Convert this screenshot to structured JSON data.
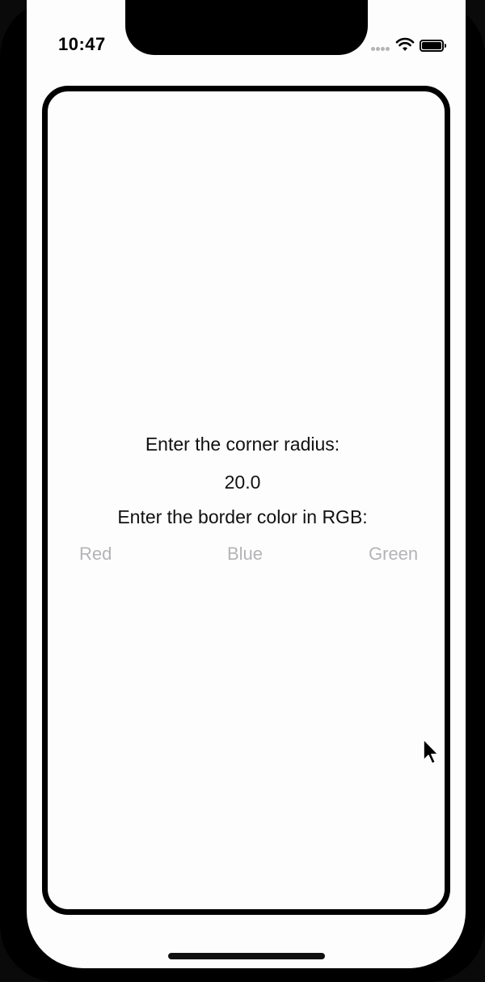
{
  "status_bar": {
    "time": "10:47",
    "signal_icon": "signal-dots-icon",
    "wifi_icon": "wifi-icon",
    "battery_icon": "battery-icon"
  },
  "form": {
    "corner_radius_label": "Enter the corner radius:",
    "corner_radius_value": "20.0",
    "border_color_label": "Enter the border color in RGB:",
    "red_placeholder": "Red",
    "blue_placeholder": "Blue",
    "green_placeholder": "Green"
  },
  "colors": {
    "background": "#fdfdfd",
    "border": "#000000",
    "placeholder": "#b4b4b8",
    "text": "#111111"
  },
  "icons": {
    "cursor": "mouse-pointer-icon"
  }
}
